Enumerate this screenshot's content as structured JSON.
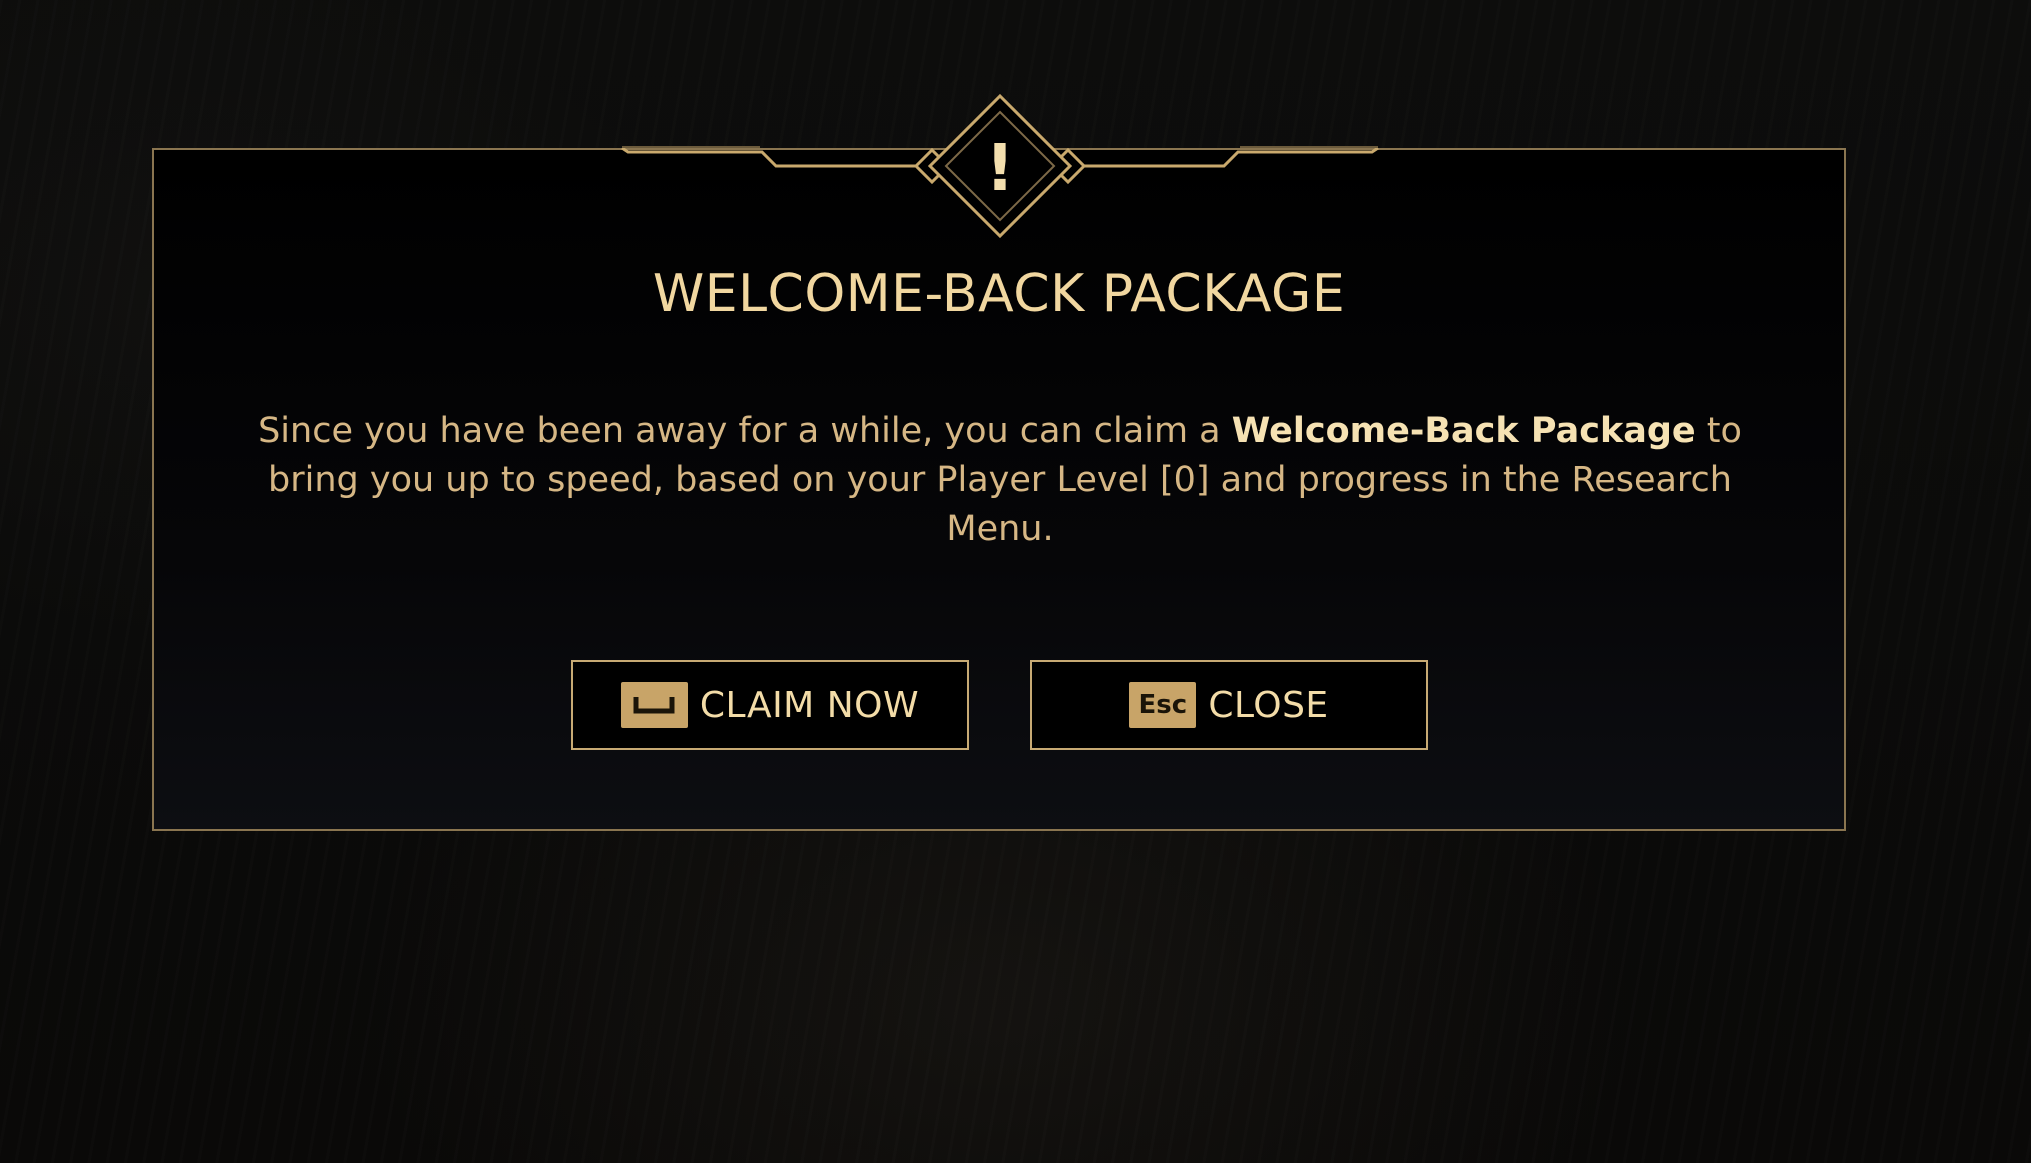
{
  "dialog": {
    "title": "WELCOME-BACK PACKAGE",
    "alert_glyph": "!",
    "body_before": "Since you have been away for a while, you can claim a ",
    "body_highlight": "Welcome-Back Package",
    "body_after": " to bring you up to speed, based on your Player Level [0] and progress in the Research Menu."
  },
  "buttons": {
    "claim": {
      "key_icon": "spacebar-icon",
      "label": "CLAIM NOW"
    },
    "close": {
      "key_label": "Esc",
      "label": "CLOSE"
    }
  },
  "colors": {
    "gold_border": "#8a7550",
    "gold_text": "#f1d7a0",
    "body_text": "#d6b785",
    "key_badge": "#c8a468",
    "background": "#0b0b0a"
  }
}
